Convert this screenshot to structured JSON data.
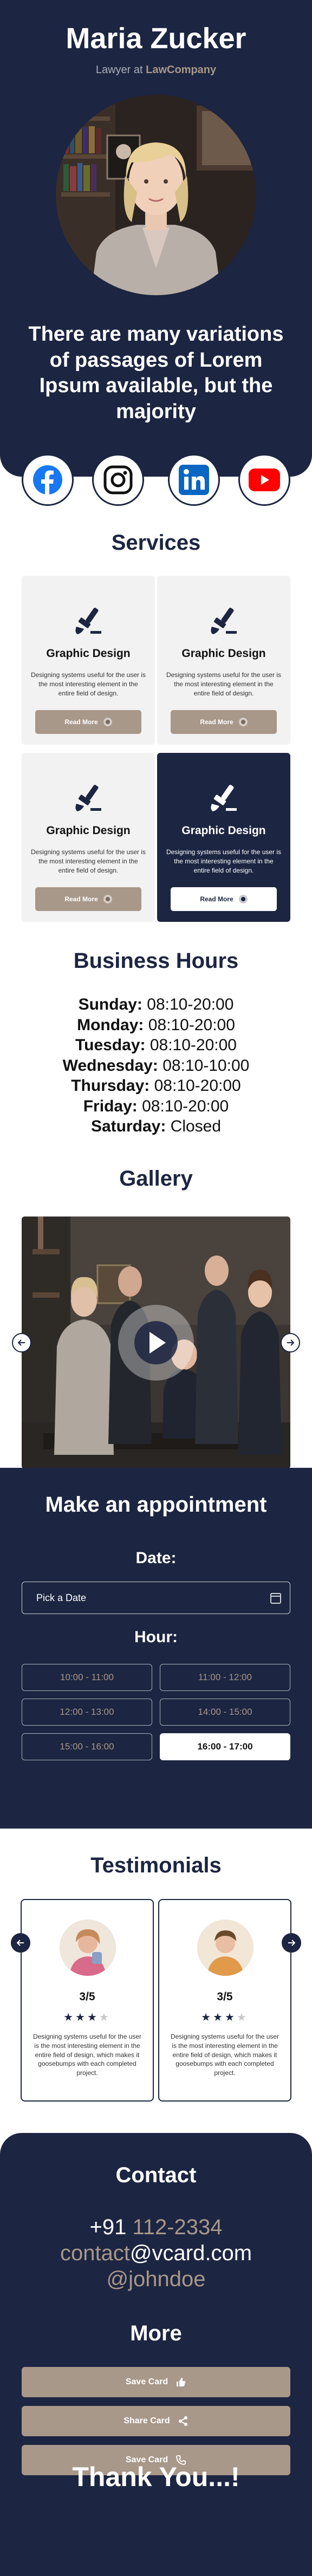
{
  "profile": {
    "name": "Maria Zucker",
    "role_prefix": "Lawyer at",
    "company": "LawCompany",
    "tagline": "There are many variations of passages of Lorem Ipsum available, but the majority"
  },
  "socials": [
    {
      "icon": "facebook-icon",
      "color": "#1877f2"
    },
    {
      "icon": "instagram-icon",
      "color": "#111111"
    },
    {
      "icon": "linkedin-icon",
      "color": "#0a66c2"
    },
    {
      "icon": "youtube-icon",
      "color": "#ff0000"
    }
  ],
  "services": {
    "title": "Services",
    "items": [
      {
        "title": "Graphic Design",
        "desc": "Designing systems useful for the user is the most interesting element in the entire field of design.",
        "button": "Read More"
      },
      {
        "title": "Graphic Design",
        "desc": "Designing systems useful for the user is the most interesting element in the entire field of design.",
        "button": "Read More"
      },
      {
        "title": "Graphic Design",
        "desc": "Designing systems useful for the user is the most interesting element in the entire field of design.",
        "button": "Read More"
      },
      {
        "title": "Graphic Design",
        "desc": "Designing systems useful for the user is the most interesting element in the entire field of design.",
        "button": "Read More"
      }
    ]
  },
  "hours": {
    "title": "Business Hours",
    "days": [
      {
        "day": "Sunday:",
        "time": "08:10-20:00"
      },
      {
        "day": "Monday:",
        "time": "08:10-20:00"
      },
      {
        "day": "Tuesday:",
        "time": "08:10-20:00"
      },
      {
        "day": "Wednesday:",
        "time": "08:10-10:00"
      },
      {
        "day": "Thursday:",
        "time": "08:10-20:00"
      },
      {
        "day": "Friday:",
        "time": "08:10-20:00"
      },
      {
        "day": "Saturday:",
        "time": "Closed"
      }
    ]
  },
  "gallery": {
    "title": "Gallery"
  },
  "appointment": {
    "title": "Make an appointment",
    "date_label": "Date:",
    "date_placeholder": "Pick a Date",
    "hour_label": "Hour:",
    "slots": [
      "10:00 - 11:00",
      "11:00 - 12:00",
      "12:00 - 13:00",
      "14:00 - 15:00",
      "15:00 - 16:00",
      "16:00 - 17:00"
    ],
    "selected_slot": "16:00 - 17:00"
  },
  "testimonials": {
    "title": "Testimonials",
    "items": [
      {
        "rating": "3/5",
        "stars": 3,
        "desc": "Designing systems useful for the user is the most interesting element in the entire field of design, which makes it goosebumps with each completed project."
      },
      {
        "rating": "3/5",
        "stars": 3,
        "desc": "Designing systems useful for the user is the most interesting element in the entire field of design, which makes it goosebumps with each completed project."
      }
    ]
  },
  "contact": {
    "title": "Contact",
    "phone_prefix": "+91 ",
    "phone_number": "112-2334",
    "email_user": "contact",
    "email_domain": "@vcard.com",
    "handle": "@johndoe"
  },
  "more": {
    "title": "More",
    "buttons": [
      {
        "label": "Save Card",
        "icon": "thumbs-up-icon"
      },
      {
        "label": "Share Card",
        "icon": "share-icon"
      },
      {
        "label": "Save Card",
        "icon": "phone-icon"
      }
    ]
  },
  "footer": {
    "thanks": "Thank You...!"
  },
  "colors": {
    "navy": "#1c2541",
    "taupe": "#a8988a",
    "card": "#f2f2f2"
  }
}
